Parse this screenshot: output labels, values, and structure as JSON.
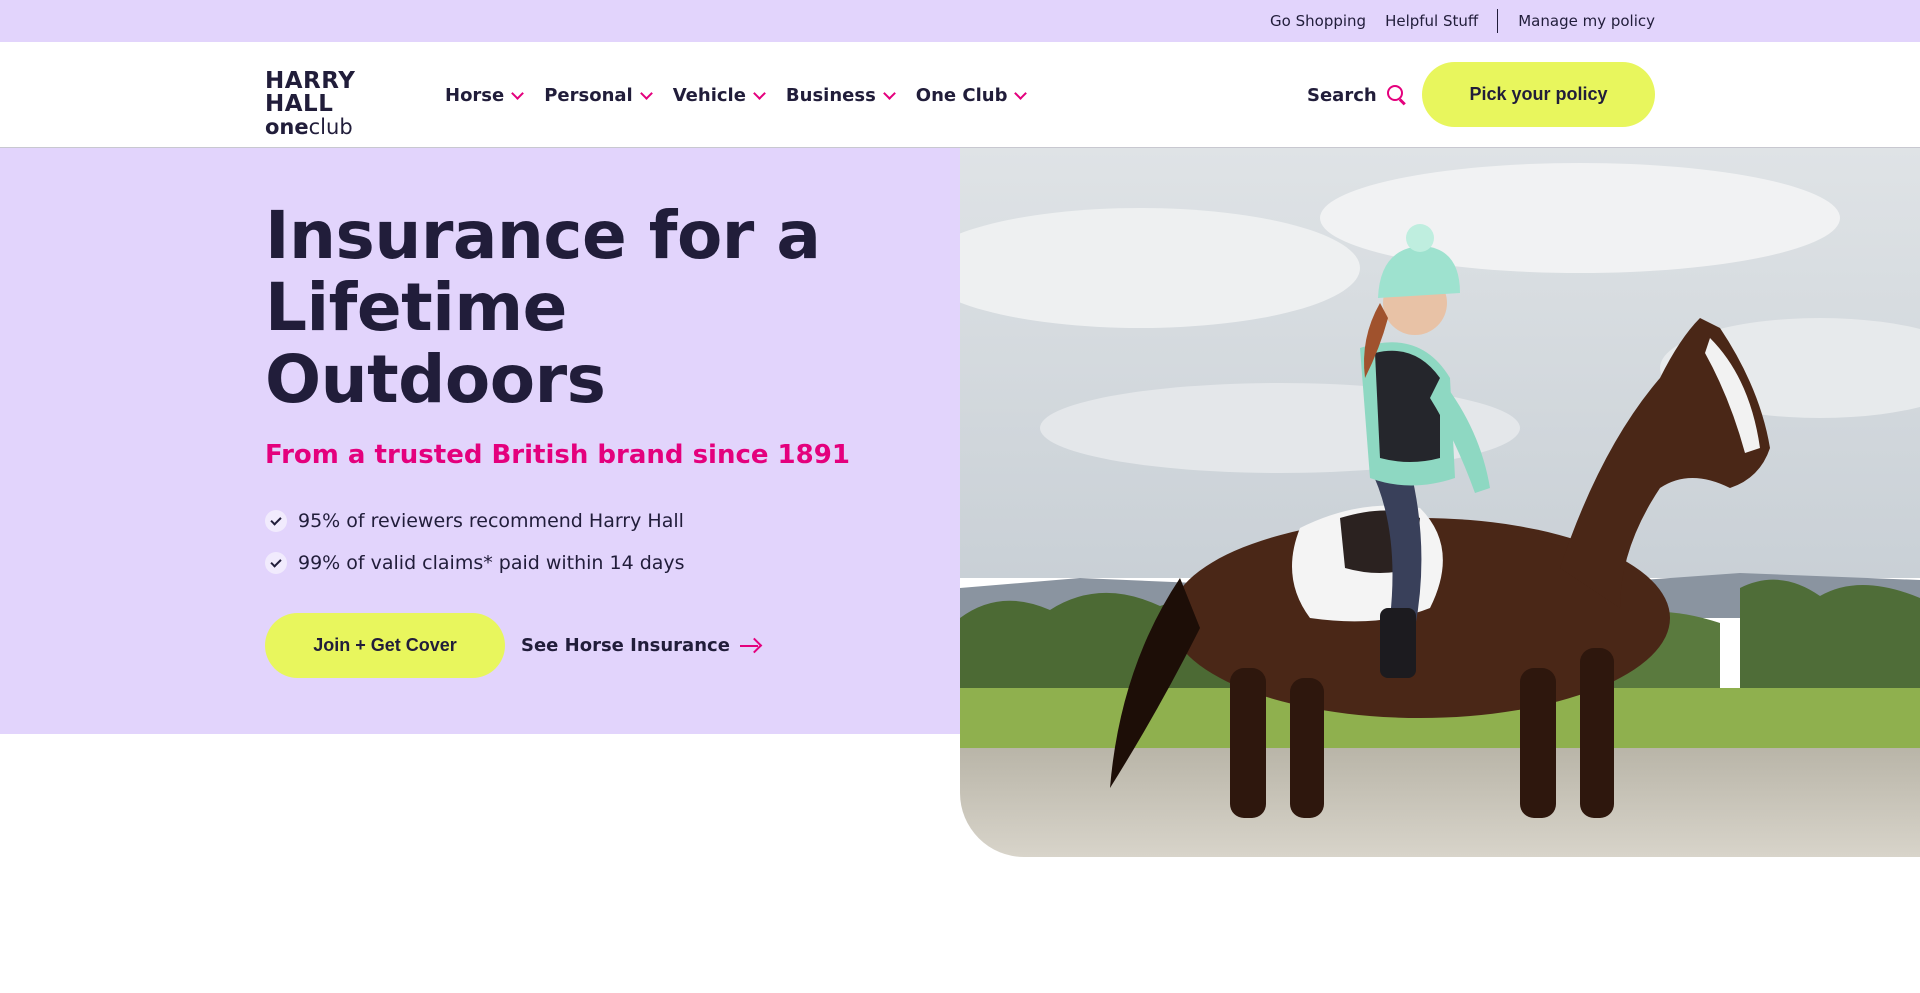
{
  "utility": {
    "go_shopping": "Go Shopping",
    "helpful_stuff": "Helpful Stuff",
    "manage_policy": "Manage my policy"
  },
  "logo": {
    "line1": "HARRY HALL",
    "line2_bold": "one",
    "line2_rest": "club"
  },
  "nav": {
    "items": [
      {
        "label": "Horse"
      },
      {
        "label": "Personal"
      },
      {
        "label": "Vehicle"
      },
      {
        "label": "Business"
      },
      {
        "label": "One Club"
      }
    ],
    "search_label": "Search",
    "cta_label": "Pick your policy"
  },
  "hero": {
    "title_line1": "Insurance for a",
    "title_line2": "Lifetime",
    "title_line3": "Outdoors",
    "subtitle": "From a trusted British brand since 1891",
    "bullets": [
      "95% of reviewers recommend Harry Hall",
      "99% of valid claims* paid within 14 days"
    ],
    "primary_button": "Join + Get Cover",
    "secondary_link": "See Horse Insurance"
  },
  "colors": {
    "lavender": "#e2d4fc",
    "navy": "#211d3a",
    "magenta": "#e4007d",
    "lime": "#e8f65d"
  }
}
